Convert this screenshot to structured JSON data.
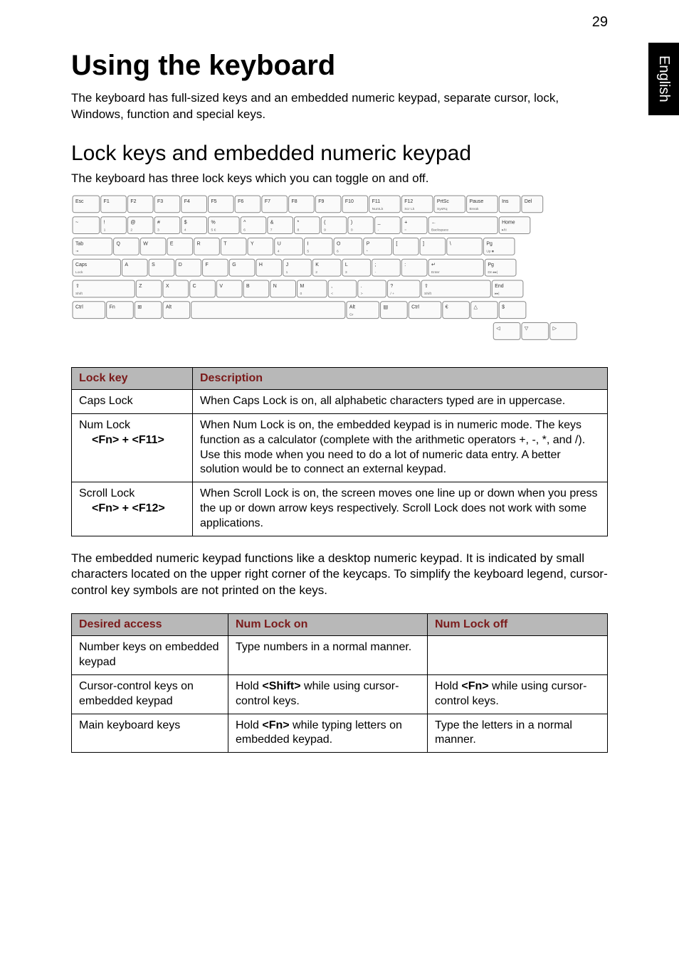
{
  "page_number": "29",
  "side_tab": "English",
  "heading": "Using the keyboard",
  "intro": "The keyboard has full-sized keys and an embedded numeric keypad, separate cursor, lock, Windows, function and special keys.",
  "subheading": "Lock keys and embedded numeric keypad",
  "subintro": "The keyboard has three lock keys which you can toggle on and off.",
  "keyboard_rows": {
    "r1": [
      "Esc",
      "F1",
      "F2",
      "F3",
      "F4",
      "F5",
      "F6",
      "F7",
      "F8",
      "F9",
      "F10",
      "F11 NumLk",
      "F12 Scr Lk",
      "PrtSc SysRq",
      "Pause Break",
      "Ins",
      "Del"
    ],
    "r2": [
      "~",
      "! 1",
      "@ 2",
      "# 3",
      "$ 4",
      "% 5 €",
      "^ 6",
      "& 7",
      "* 8",
      "( 9",
      ") 0",
      "_ -",
      "+ =",
      "← Backspace",
      "Home ▸/II"
    ],
    "r3": [
      "Tab ⇥",
      "Q",
      "W",
      "E",
      "R",
      "T",
      "Y",
      "U 4",
      "I 5",
      "O 6",
      "P *",
      "[",
      "]",
      "\\",
      "Pg Up ■"
    ],
    "r4": [
      "Caps Lock",
      "A",
      "S",
      "D",
      "F",
      "G",
      "H",
      "J 1",
      "K 2",
      "L 3",
      "; -",
      ":",
      "↵ Enter",
      "Pg Dn ▸▸|"
    ],
    "r5": [
      "⇧ Shift",
      "Z",
      "X",
      "C",
      "V",
      "B",
      "N",
      "M 0",
      ", <",
      ". >",
      "? / +",
      "⇧ Shift",
      "End ▸▸|"
    ],
    "r6": [
      "Ctrl",
      "Fn",
      "⊞",
      "Alt",
      "",
      "Alt Gr",
      "▤",
      "Ctrl",
      "€",
      "△",
      "$"
    ],
    "r7": [
      "◁",
      "▽",
      "▷"
    ]
  },
  "lock_table": {
    "headers": [
      "Lock key",
      "Description"
    ],
    "rows": [
      {
        "key": "Caps Lock",
        "sub": "",
        "desc": "When Caps Lock is on, all alphabetic characters typed are in uppercase."
      },
      {
        "key": "Num Lock",
        "sub": "<Fn> + <F11>",
        "desc": "When Num Lock is on, the embedded keypad is in numeric mode. The keys function as a calculator (complete with the arithmetic operators +, -, *, and /). Use this mode when you need to do a lot of numeric data entry. A better solution would be to connect an external keypad."
      },
      {
        "key": "Scroll Lock",
        "sub": "<Fn> + <F12>",
        "desc": "When Scroll Lock is on, the screen moves one line up or down when you press the up or down arrow keys respectively. Scroll Lock does not work with some applications."
      }
    ]
  },
  "body_para": "The embedded numeric keypad functions like a desktop numeric keypad. It is indicated by small characters located on the upper right corner of the keycaps. To simplify the keyboard legend, cursor-control key symbols are not printed on the keys.",
  "access_table": {
    "headers": [
      "Desired access",
      "Num Lock on",
      "Num Lock off"
    ],
    "rows": [
      {
        "c1": "Number keys on embedded keypad",
        "c2": "Type numbers in a normal manner.",
        "c3": ""
      },
      {
        "c1": "Cursor-control keys on embedded keypad",
        "c2_pre": "Hold ",
        "c2_bold": "<Shift>",
        "c2_post": " while using cursor-control keys.",
        "c3_pre": "Hold ",
        "c3_bold": "<Fn>",
        "c3_post": " while using cursor-control keys."
      },
      {
        "c1": "Main keyboard keys",
        "c2_pre": "Hold ",
        "c2_bold": "<Fn>",
        "c2_post": " while typing letters on embedded keypad.",
        "c3": "Type the letters in a normal manner."
      }
    ]
  }
}
